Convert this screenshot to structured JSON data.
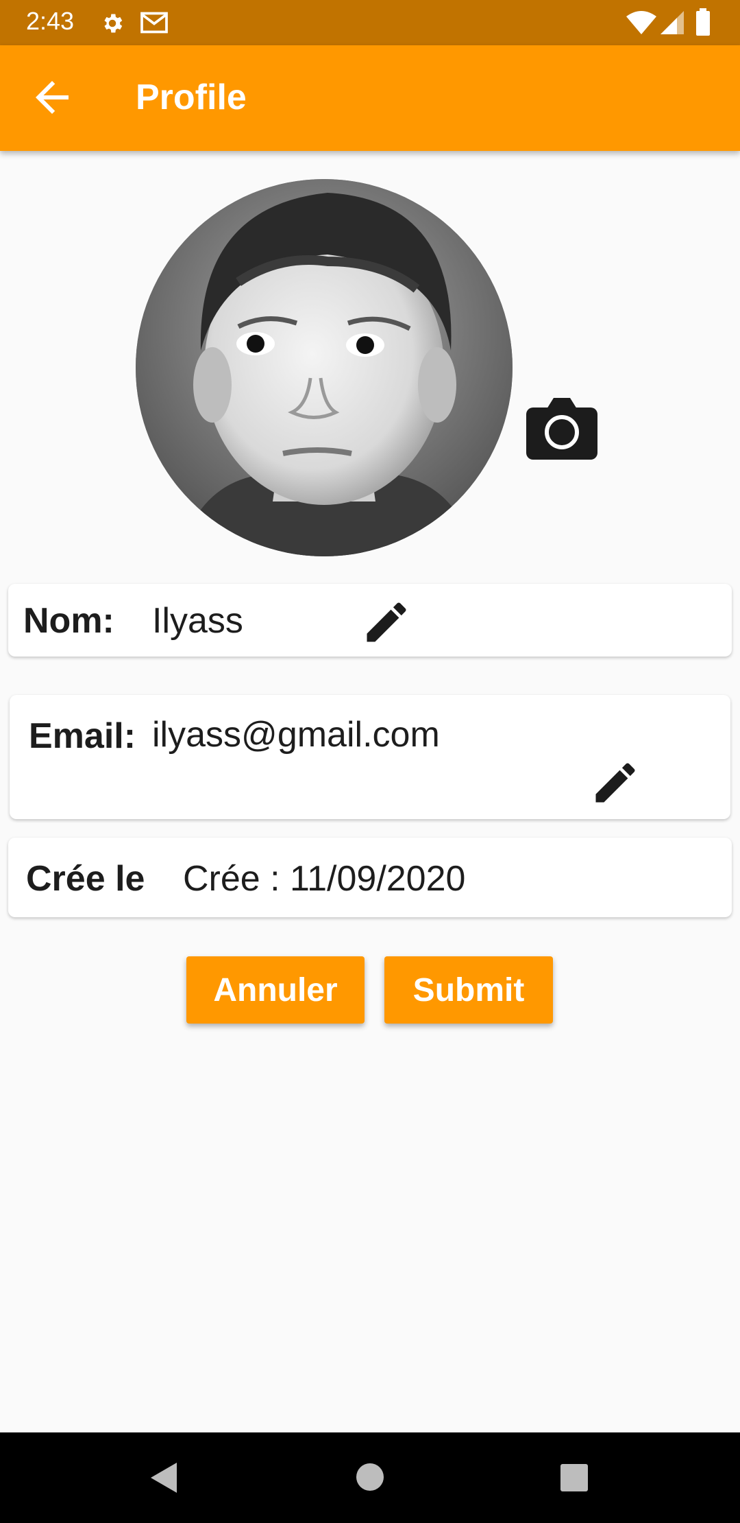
{
  "status_bar": {
    "time": "2:43",
    "icons": [
      "settings-icon",
      "gmail-icon",
      "wifi-icon",
      "signal-icon",
      "battery-icon"
    ]
  },
  "app_bar": {
    "title": "Profile",
    "back_icon": "arrow-back-icon",
    "color": "#ff9800"
  },
  "profile": {
    "photo_icon": "camera-icon",
    "name_label": "Nom:",
    "name_value": "Ilyass",
    "email_label": "Email:",
    "email_value": "ilyass@gmail.com",
    "created_label": "Crée le",
    "created_value": "Crée : 11/09/2020"
  },
  "actions": {
    "cancel_label": "Annuler",
    "submit_label": "Submit"
  },
  "nav_bar": {
    "icons": [
      "back-triangle-icon",
      "home-circle-icon",
      "recents-square-icon"
    ]
  }
}
